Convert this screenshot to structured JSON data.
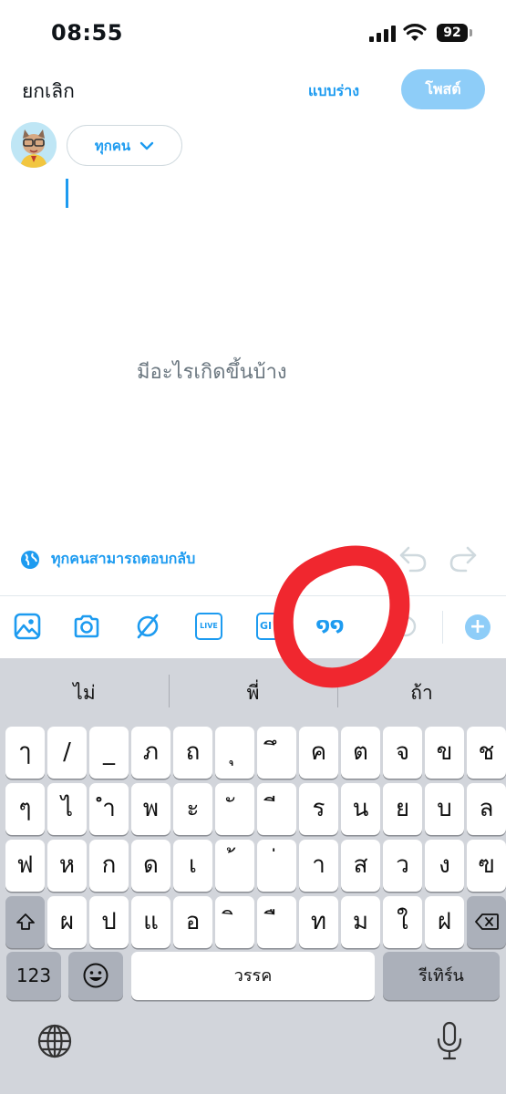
{
  "status_bar": {
    "time": "08:55",
    "battery": "92"
  },
  "header": {
    "cancel_label": "ยกเลิก",
    "drafts_label": "แบบร่าง",
    "post_label": "โพสต์"
  },
  "composer": {
    "audience_label": "ทุกคน",
    "placeholder": "มีอะไรเกิดขึ้นบ้าง"
  },
  "reply_setting": {
    "label": "ทุกคนสามารถตอบกลับ"
  },
  "toolbar": {
    "items": [
      "image-icon",
      "camera-icon",
      "no-sign-icon",
      "live-icon",
      "gif-icon",
      "quote-icon",
      "circle-icon",
      "add-icon"
    ],
    "live_text": "LIVE",
    "gif_text": "GI",
    "quote_text": "໑໑"
  },
  "keyboard": {
    "suggestions": [
      "ไม่",
      "พี่",
      "ถ้า"
    ],
    "row1": [
      "ๅ",
      "/",
      "_",
      "ภ",
      "ถ",
      "ุ",
      "ึ",
      "ค",
      "ต",
      "จ",
      "ข",
      "ช"
    ],
    "row2": [
      "ๆ",
      "ไ",
      "ำ",
      "พ",
      "ะ",
      "ั",
      "ี",
      "ร",
      "น",
      "ย",
      "บ",
      "ล"
    ],
    "row3": [
      "ฟ",
      "ห",
      "ก",
      "ด",
      "เ",
      "้",
      "่",
      "า",
      "ส",
      "ว",
      "ง",
      "ฃ"
    ],
    "row4": [
      "ผ",
      "ป",
      "แ",
      "อ",
      "ิ",
      "ื",
      "ท",
      "ม",
      "ใ",
      "ฝ"
    ],
    "numbers_label": "123",
    "space_label": "วรรค",
    "return_label": "รีเทิร์น"
  },
  "colors": {
    "accent": "#1d9bf0",
    "post_disabled": "#8ecdf8",
    "annotation": "#f0272f",
    "keyboard_bg": "#d2d5db"
  }
}
